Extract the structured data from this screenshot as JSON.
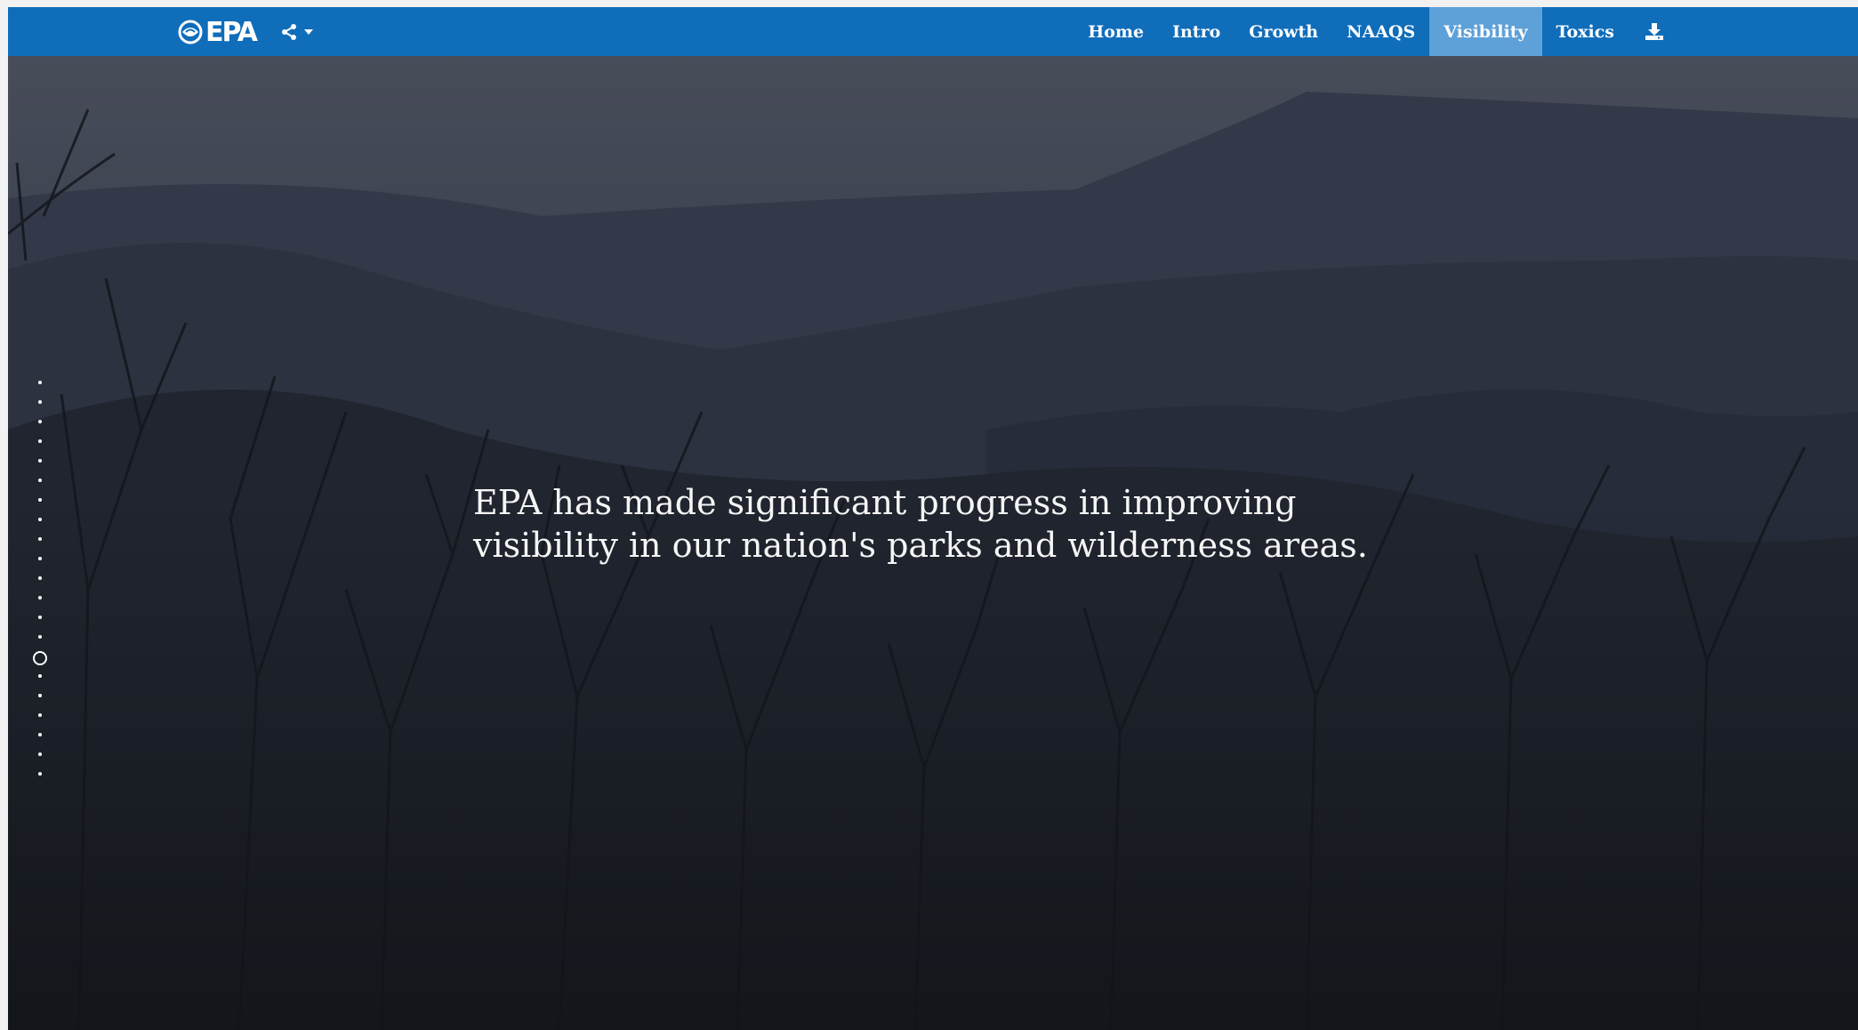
{
  "app": {
    "logo_text": "EPA"
  },
  "nav": {
    "items": [
      {
        "label": "Home",
        "active": false
      },
      {
        "label": "Intro",
        "active": false
      },
      {
        "label": "Growth",
        "active": false
      },
      {
        "label": "NAAQS",
        "active": false
      },
      {
        "label": "Visibility",
        "active": true
      },
      {
        "label": "Toxics",
        "active": false
      }
    ],
    "share_icon": "share-icon",
    "download_icon": "download-icon"
  },
  "hero": {
    "headline_line1": "EPA has made significant progress in improving",
    "headline_line2": "visibility in our nation's parks and wilderness areas."
  },
  "dot_nav": {
    "count": 21,
    "active_index": 14
  },
  "colors": {
    "navbar": "#0f6dba",
    "nav_active": "#5ea0d8",
    "text": "#ffffff"
  }
}
